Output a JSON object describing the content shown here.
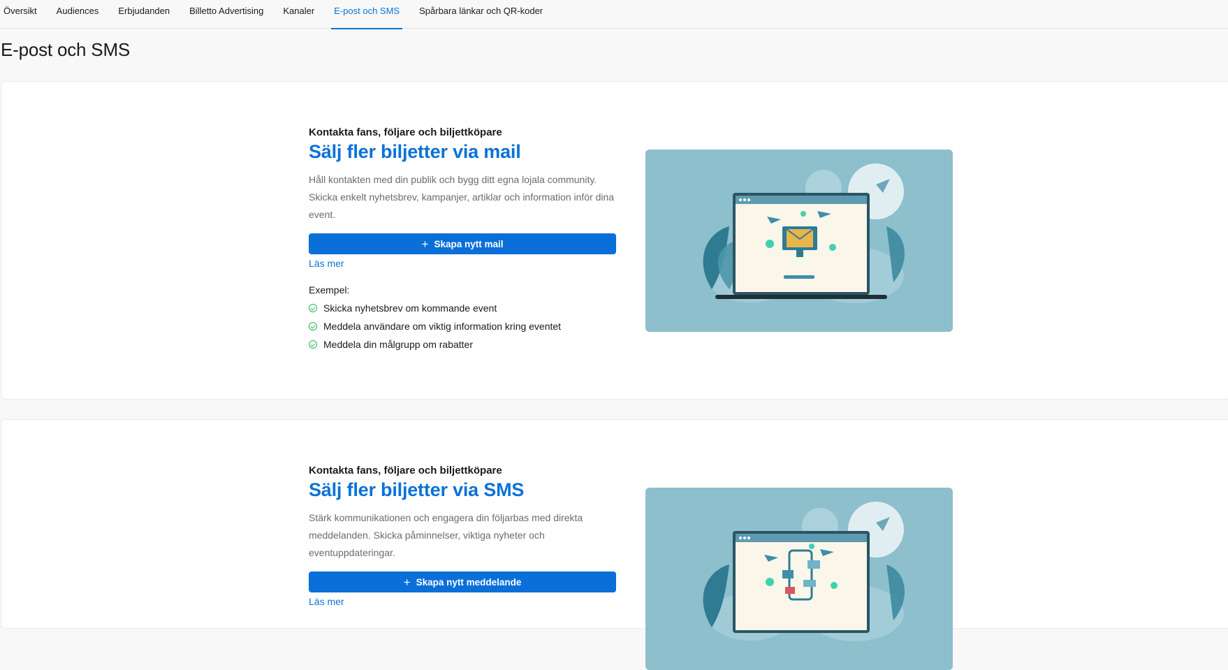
{
  "nav": {
    "tabs": [
      {
        "label": "Översikt"
      },
      {
        "label": "Audiences"
      },
      {
        "label": "Erbjudanden"
      },
      {
        "label": "Billetto Advertising"
      },
      {
        "label": "Kanaler"
      },
      {
        "label": "E-post och SMS"
      },
      {
        "label": "Spårbara länkar och QR-koder"
      }
    ],
    "active_tab": "E-post och SMS"
  },
  "page": {
    "title": "E-post och SMS"
  },
  "cards": [
    {
      "eyebrow": "Kontakta fans, följare och biljettköpare",
      "headline": "Sälj fler biljetter via mail",
      "description": "Håll kontakten med din publik och bygg ditt egna lojala community. Skicka enkelt nyhetsbrev, kampanjer, artiklar och information inför dina event.",
      "cta_label": "Skapa nytt mail",
      "more_label": "Läs mer",
      "examples_label": "Exempel:",
      "examples": [
        "Skicka nyhetsbrev om kommande event",
        "Meddela användare om viktig information kring eventet",
        "Meddela din målgrupp om rabatter"
      ],
      "illustration_icon": "email-laptop-illustration"
    },
    {
      "eyebrow": "Kontakta fans, följare och biljettköpare",
      "headline": "Sälj fler biljetter via SMS",
      "description": "Stärk kommunikationen och engagera din följarbas med direkta meddelanden. Skicka påminnelser, viktiga nyheter och eventuppdateringar.",
      "cta_label": "Skapa nytt meddelande",
      "more_label": "Läs mer",
      "illustration_icon": "sms-laptop-illustration"
    }
  ],
  "colors": {
    "accent": "#0a72d8",
    "button": "#0a6fd8",
    "check": "#2bb55a",
    "illustration_bg": "#8dbfcc"
  }
}
